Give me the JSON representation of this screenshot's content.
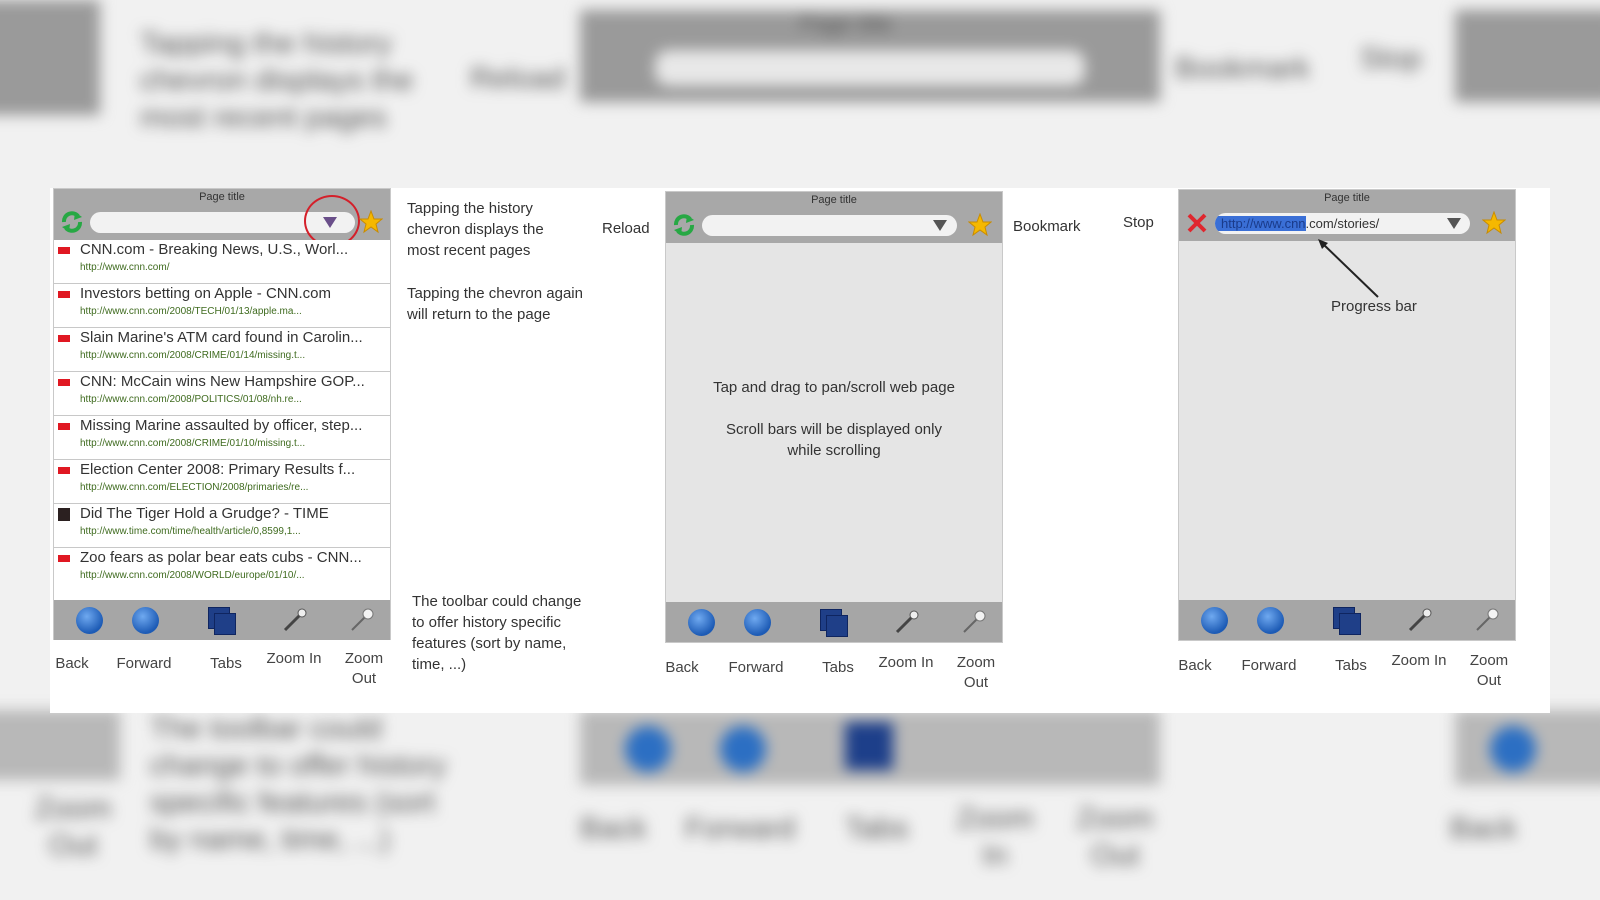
{
  "history_view": {
    "page_title": "Page title",
    "entries": [
      {
        "title": "CNN.com - Breaking News, U.S., Worl...",
        "url": "http://www.cnn.com/",
        "flag": "red"
      },
      {
        "title": "Investors betting on Apple - CNN.com",
        "url": "http://www.cnn.com/2008/TECH/01/13/apple.ma...",
        "flag": "red"
      },
      {
        "title": "Slain Marine's ATM card found in Carolin...",
        "url": "http://www.cnn.com/2008/CRIME/01/14/missing.t...",
        "flag": "red"
      },
      {
        "title": "CNN: McCain wins New Hampshire GOP...",
        "url": "http://www.cnn.com/2008/POLITICS/01/08/nh.re...",
        "flag": "red"
      },
      {
        "title": "Missing Marine assaulted by officer, step...",
        "url": "http://www.cnn.com/2008/CRIME/01/10/missing.t...",
        "flag": "red"
      },
      {
        "title": "Election Center 2008: Primary Results f...",
        "url": "http://www.cnn.com/ELECTION/2008/primaries/re...",
        "flag": "red"
      },
      {
        "title": "Did The Tiger Hold a Grudge? - TIME",
        "url": "http://www.time.com/time/health/article/0,8599,1...",
        "flag": "dark"
      },
      {
        "title": "Zoo fears as polar bear eats cubs - CNN...",
        "url": "http://www.cnn.com/2008/WORLD/europe/01/10/...",
        "flag": "red"
      }
    ],
    "note_history": "Tapping the history chevron displays the most recent pages",
    "note_chevron": "Tapping the chevron again will return to the page",
    "note_toolbar": "The toolbar could change to offer history specific features (sort by name, time, ...)"
  },
  "browse_view": {
    "page_title": "Page title",
    "label_reload": "Reload",
    "label_bookmark": "Bookmark",
    "text_pan": "Tap and drag to pan/scroll web page",
    "text_scroll": "Scroll bars will be displayed only while scrolling"
  },
  "loading_view": {
    "page_title": "Page title",
    "label_stop": "Stop",
    "url_selected": "http://www.cnn",
    "url_rest": ".com/stories/",
    "label_progress": "Progress bar"
  },
  "toolbar": {
    "back": "Back",
    "forward": "Forward",
    "tabs": "Tabs",
    "zoom_in": "Zoom In",
    "zoom_out": "Zoom Out"
  },
  "backdrop": {
    "note_history": "Tapping the history chevron displays the most recent pages",
    "label_reload": "Reload",
    "page_title": "Page title",
    "label_bookmark": "Bookmark",
    "label_stop": "Stop",
    "note_toolbar": "The toolbar could change to offer history specific features (sort by name, time, ...)",
    "zoom_out": "Zoom Out",
    "back": "Back",
    "forward": "Forward",
    "tabs": "Tabs",
    "zoom_in": "Zoom In"
  },
  "colors": {
    "chrome_gray": "#a8a8a8",
    "highlight_circle": "#d4202a",
    "star": "#f5b800",
    "reload_green": "#27a844",
    "stop_red": "#e0262e",
    "nav_blue": "#1d5bb5"
  },
  "icons": [
    "reload-icon",
    "chevron-down-icon",
    "star-icon",
    "stop-icon",
    "back-icon",
    "forward-icon",
    "tabs-icon",
    "zoom-in-icon",
    "zoom-out-icon",
    "cnn-logo-icon"
  ]
}
